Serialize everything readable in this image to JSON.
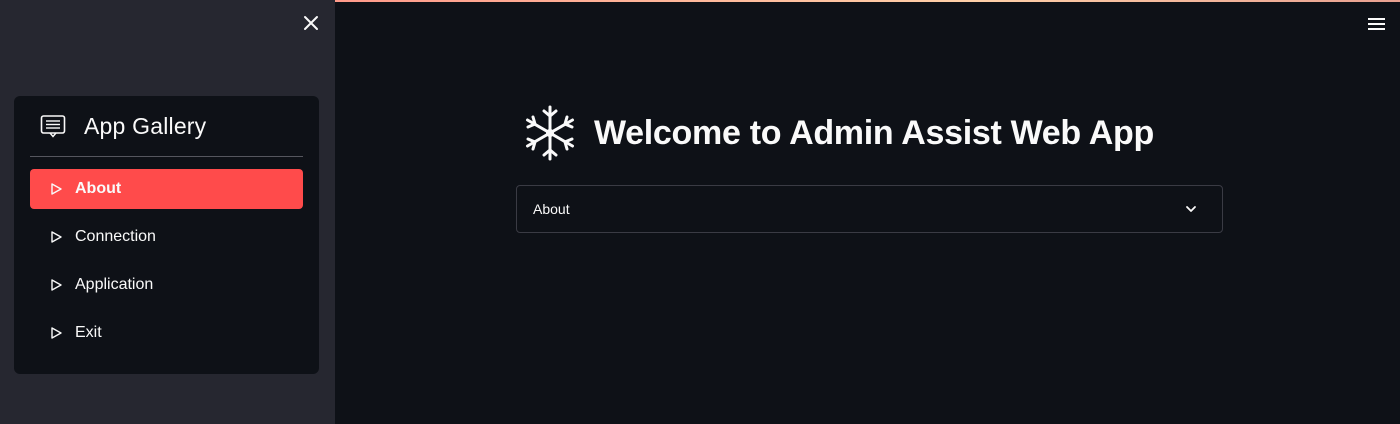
{
  "sidebar": {
    "menu_title": "App Gallery",
    "items": [
      {
        "label": "About",
        "active": true
      },
      {
        "label": "Connection",
        "active": false
      },
      {
        "label": "Application",
        "active": false
      },
      {
        "label": "Exit",
        "active": false
      }
    ]
  },
  "main": {
    "heading": "Welcome to Admin Assist Web App",
    "expander": {
      "label": "About",
      "expanded": false
    }
  },
  "colors": {
    "accent": "#ff4b4b",
    "sidebar_bg": "#262730",
    "main_bg": "#0e1117",
    "text": "#fafafa"
  },
  "icons": {
    "close": "close-icon",
    "menu_header": "card-list-icon",
    "nav_item": "triangle-right-icon",
    "heading": "snowflake-icon",
    "expander": "chevron-down-icon",
    "app_menu": "hamburger-icon"
  }
}
